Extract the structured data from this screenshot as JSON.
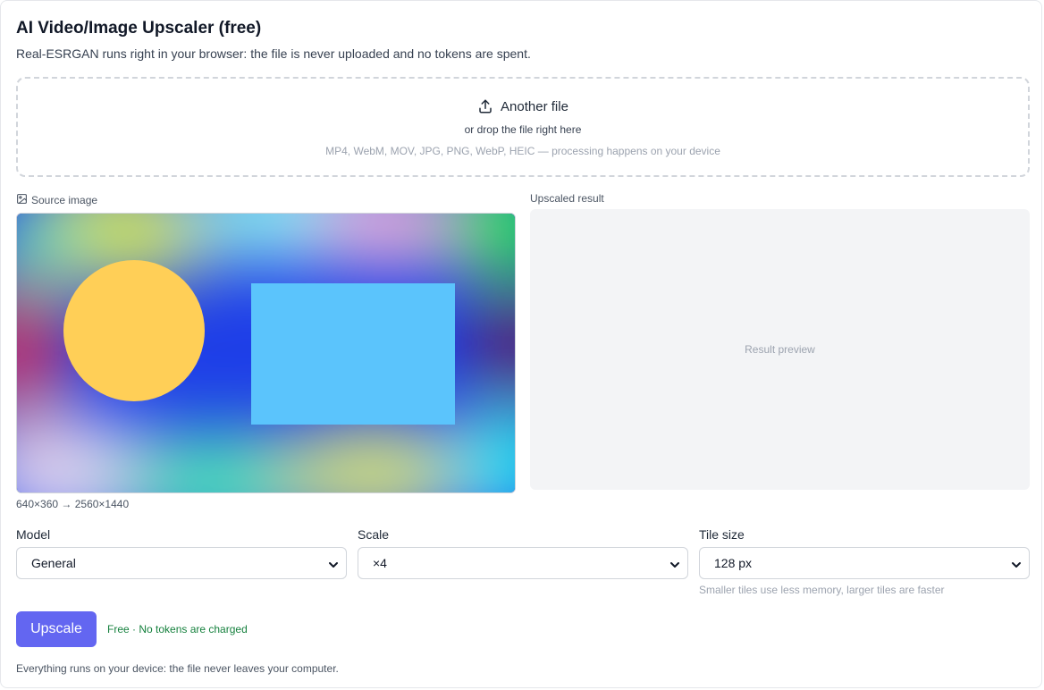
{
  "header": {
    "title": "AI Video/Image Upscaler (free)",
    "subtitle": "Real-ESRGAN runs right in your browser: the file is never uploaded and no tokens are spent."
  },
  "dropzone": {
    "button_label": "Another file",
    "sub_text": "or drop the file right here",
    "hint": "MP4, WebM, MOV, JPG, PNG, WebP, HEIC — processing happens on your device",
    "icon": "upload-icon"
  },
  "source": {
    "label": "Source image",
    "icon": "image-icon",
    "dimensions": "640×360 → 2560×1440"
  },
  "result": {
    "label": "Upscaled result",
    "placeholder": "Result preview"
  },
  "settings": {
    "model": {
      "label": "Model",
      "value": "General"
    },
    "scale": {
      "label": "Scale",
      "value": "×4"
    },
    "tile_size": {
      "label": "Tile size",
      "value": "128 px",
      "help": "Smaller tiles use less memory, larger tiles are faster"
    }
  },
  "actions": {
    "upscale_label": "Upscale",
    "free_note": "Free · No tokens are charged"
  },
  "footer": {
    "note": "Everything runs on your device: the file never leaves your computer."
  },
  "colors": {
    "accent": "#6366f1",
    "free_green": "#15803d",
    "preview_bg": "#f3f4f6"
  }
}
